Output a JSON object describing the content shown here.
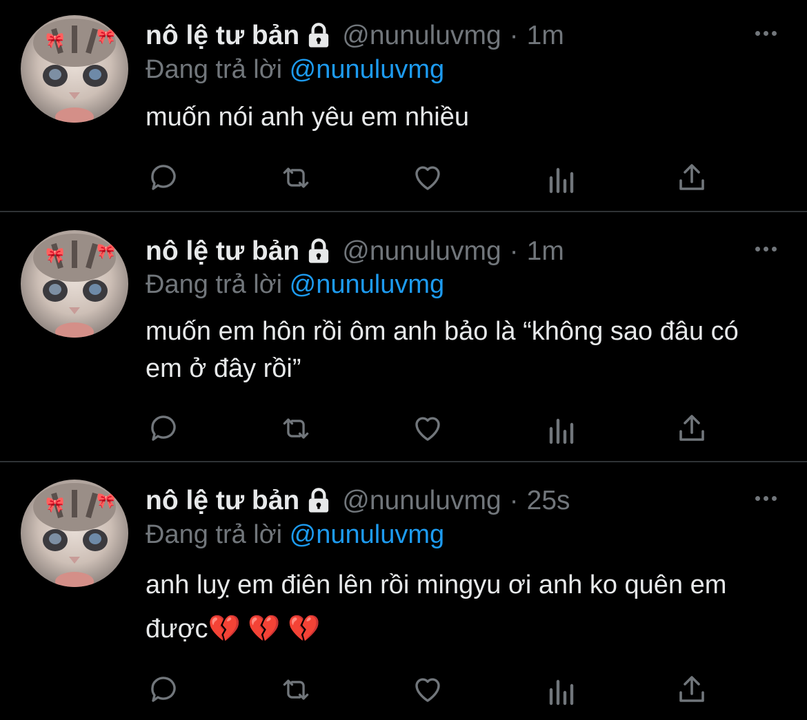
{
  "colors": {
    "background": "#000000",
    "text": "#e7e9ea",
    "muted": "#71767b",
    "accent": "#1d9bf0",
    "divider": "#2f3336",
    "heart_emoji": "#e0245e"
  },
  "icons": {
    "lock": "lock-icon",
    "more": "more-icon",
    "reply": "reply-icon",
    "retweet": "retweet-icon",
    "like": "heart-icon",
    "views": "views-icon",
    "share": "share-icon"
  },
  "tweets": [
    {
      "name": "nô lệ tư bản",
      "handle": "@nunuluvmg",
      "dot": "·",
      "time": "1m",
      "replying_label": "Đang trả lời",
      "replying_to": "@nunuluvmg",
      "text": "muốn nói anh yêu em nhiều"
    },
    {
      "name": "nô lệ tư bản",
      "handle": "@nunuluvmg",
      "dot": "·",
      "time": "1m",
      "replying_label": "Đang trả lời",
      "replying_to": "@nunuluvmg",
      "text": "muốn em hôn rồi ôm anh bảo là “không sao đâu có em ở đây rồi”"
    },
    {
      "name": "nô lệ tư bản",
      "handle": "@nunuluvmg",
      "dot": "·",
      "time": "25s",
      "replying_label": "Đang trả lời",
      "replying_to": "@nunuluvmg",
      "text": "anh luỵ em điên lên rồi mingyu ơi anh ko quên em được💔 💔 💔"
    }
  ]
}
